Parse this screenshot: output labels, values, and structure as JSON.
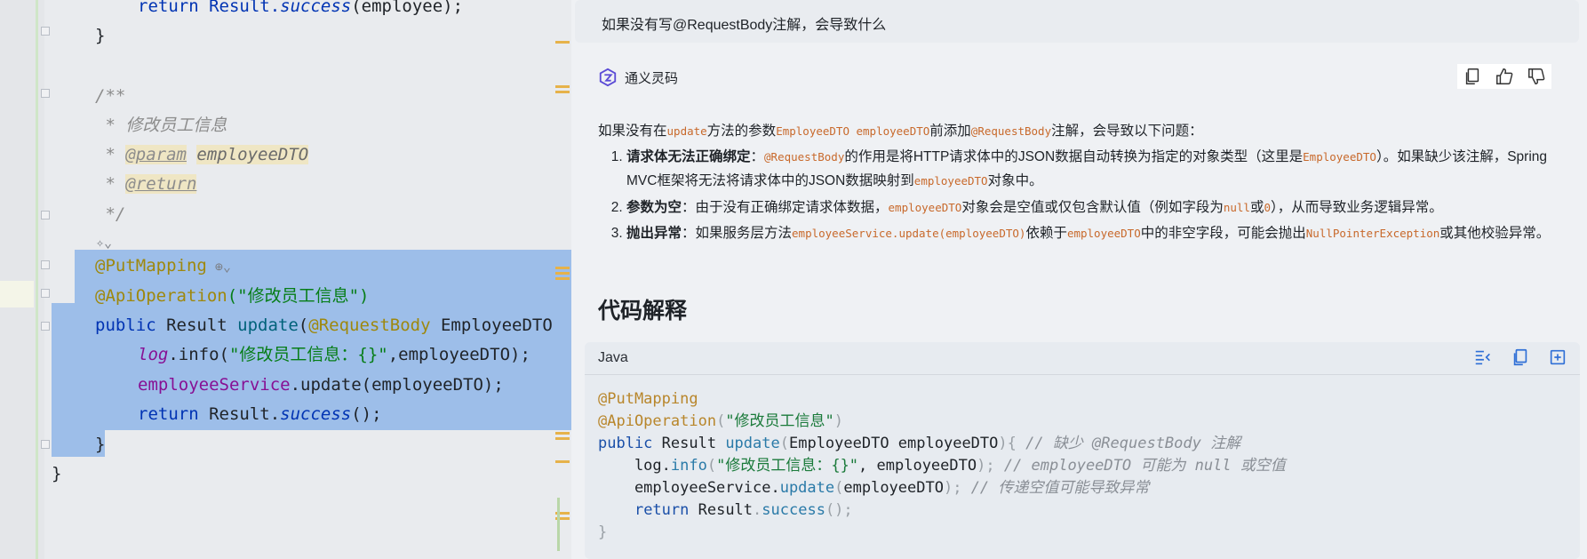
{
  "editor": {
    "lines": {
      "l0": "return Result.",
      "l0_method": "success",
      "l0_tail": "(employee);",
      "l1": "}",
      "l2": "/**",
      "l3": " * 修改员工信息",
      "l4_tag": "@param",
      "l4_val": "employeeDTO",
      "l5_tag": "@return",
      "l6": " */",
      "l7_ann": "@PutMapping",
      "l8_ann": "@ApiOperation",
      "l8_str": "(\"修改员工信息\")",
      "l9_kw": "public",
      "l9_mid": " Result ",
      "l9_fn": "update",
      "l9_paren": "(",
      "l9_ann": "@RequestBody",
      "l9_tail": " EmployeeDTO",
      "l10_log": "log",
      "l10_info": ".info(",
      "l10_str": "\"修改员工信息：{}\"",
      "l10_tail": ",employeeDTO);",
      "l11_fld": "employeeService",
      "l11_tail": ".update(employeeDTO);",
      "l12_kw": "return",
      "l12_mid": " Result.",
      "l12_method": "success",
      "l12_tail": "();",
      "l13": "}",
      "l14": "}"
    }
  },
  "chat": {
    "question": "如果没有写@RequestBody注解，会导致什么",
    "brand": "通义灵码",
    "intro": {
      "a": "如果没有在",
      "code1": "update",
      "b": "方法的参数",
      "code2": "EmployeeDTO employeeDTO",
      "c": "前添加",
      "code3": "@RequestBody",
      "d": "注解，会导致以下问题："
    },
    "items": [
      {
        "title": "请求体无法正确绑定",
        "p1": "：",
        "c1": "@RequestBody",
        "p2": "的作用是将HTTP请求体中的JSON数据自动转换为指定的对象类型（这里是",
        "c2": "EmployeeDTO",
        "p3": "）。如果缺少该注解，Spring MVC框架将无法将请求体中的JSON数据映射到",
        "c3": "employeeDTO",
        "p4": "对象中。"
      },
      {
        "title": "参数为空",
        "p1": "：由于没有正确绑定请求体数据，",
        "c1": "employeeDTO",
        "p2": "对象会是空值或仅包含默认值（例如字段为",
        "c2": "null",
        "p3": "或",
        "c3": "0",
        "p4": "），从而导致业务逻辑异常。"
      },
      {
        "title": "抛出异常",
        "p1": "：如果服务层方法",
        "c1": "employeeService.update(employeeDTO)",
        "p2": "依赖于",
        "c2": "employeeDTO",
        "p3": "中的非空字段，可能会抛出",
        "c3": "NullPointerException",
        "p4": "或其他校验异常。"
      }
    ],
    "section_title": "代码解释",
    "code_lang": "Java",
    "code": {
      "r1": "@PutMapping",
      "r2a": "@ApiOperation",
      "r2b": "(",
      "r2c": "\"修改员工信息\"",
      "r2d": ")",
      "r3a": "public",
      "r3b": " Result ",
      "r3c": "update",
      "r3d": "(",
      "r3e": "EmployeeDTO employeeDTO",
      "r3f": "){",
      "r3g": " // 缺少 @RequestBody 注解",
      "r4a": "    log.",
      "r4b": "info",
      "r4c": "(",
      "r4d": "\"修改员工信息：{}\"",
      "r4e": ", employeeDTO",
      "r4f": ");",
      "r4g": " // employeeDTO 可能为 null 或空值",
      "r5a": "    employeeService.",
      "r5b": "update",
      "r5c": "(",
      "r5d": "employeeDTO",
      "r5e": ");",
      "r5f": " // 传递空值可能导致异常",
      "r6a": "    ",
      "r6b": "return",
      "r6c": " Result",
      "r6d": ".",
      "r6e": "success",
      "r6f": "();",
      "r7": "}"
    }
  },
  "colors": {
    "selection": "#8fb6e8",
    "annotation": "#9e880d",
    "keyword": "#0033b3",
    "inline_code": "#c8692b"
  }
}
